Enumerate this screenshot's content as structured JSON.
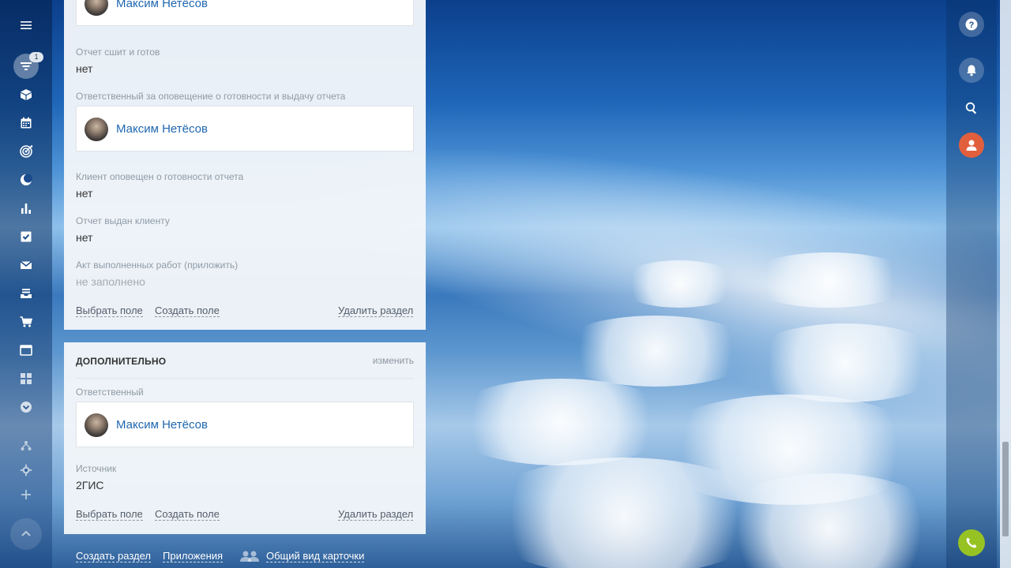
{
  "sidebar": {
    "items": [
      {
        "icon": "menu-icon"
      },
      {
        "icon": "filter-icon",
        "badge": "1"
      },
      {
        "icon": "cube-icon"
      },
      {
        "icon": "calendar-icon"
      },
      {
        "icon": "target-icon"
      },
      {
        "icon": "moon-icon"
      },
      {
        "icon": "bar-chart-icon"
      },
      {
        "icon": "checkbox-icon"
      },
      {
        "icon": "mail-icon"
      },
      {
        "icon": "inbox-tray-icon"
      },
      {
        "icon": "cart-icon"
      },
      {
        "icon": "window-icon"
      },
      {
        "icon": "grid-icon"
      },
      {
        "icon": "chevron-down-circle-icon"
      },
      {
        "icon": "sitemap-icon"
      },
      {
        "icon": "gear-icon"
      },
      {
        "icon": "plus-icon"
      }
    ]
  },
  "top_card": {
    "person_top": "Максим Нетёсов",
    "fields": [
      {
        "label": "Отчет сшит и готов",
        "value": "нет"
      },
      {
        "label": "Ответственный за оповещение о готовности и выдачу отчета",
        "person": "Максим Нетёсов"
      },
      {
        "label": "Клиент оповещен о готовности отчета",
        "value": "нет"
      },
      {
        "label": "Отчет выдан клиенту",
        "value": "нет"
      },
      {
        "label": "Акт выполненных работ (приложить)",
        "value": "не заполнено"
      }
    ],
    "select_field": "Выбрать поле",
    "create_field": "Создать поле",
    "delete_section": "Удалить раздел"
  },
  "bottom_card": {
    "title": "ДОПОЛНИТЕЛЬНО",
    "edit": "изменить",
    "responsible_label": "Ответственный",
    "responsible_person": "Максим Нетёсов",
    "source_label": "Источник",
    "source_value": "2ГИС",
    "select_field": "Выбрать поле",
    "create_field": "Создать поле",
    "delete_section": "Удалить раздел"
  },
  "footer_links": {
    "create_section": "Создать раздел",
    "applications": "Приложения",
    "card_view": "Общий вид карточки"
  },
  "right_rail": [
    "help-icon",
    "bell-icon",
    "search-icon",
    "user-icon",
    "phone-icon"
  ],
  "colors": {
    "link_blue": "#2067b0",
    "user_orange": "#e25f3d",
    "call_green": "#97c224"
  }
}
